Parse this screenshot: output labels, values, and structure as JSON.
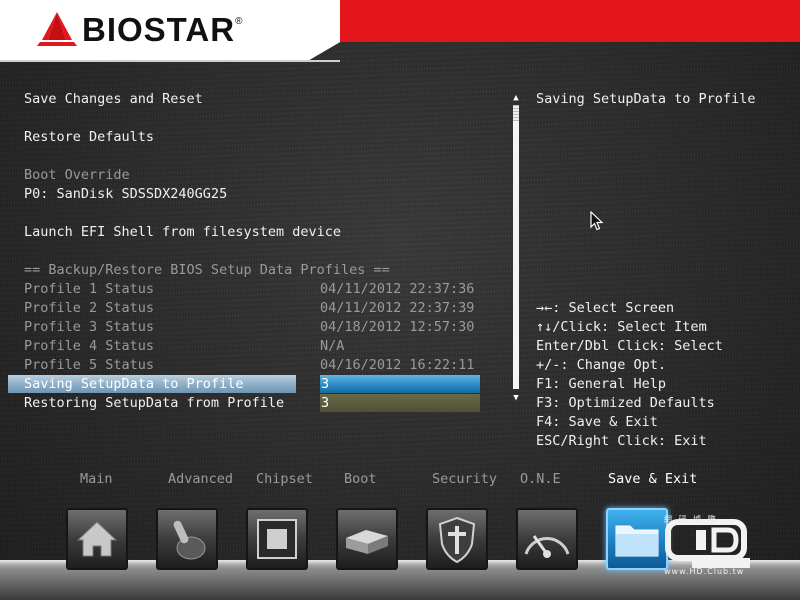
{
  "brand": {
    "name": "BIOSTAR",
    "registered": "®"
  },
  "menu": {
    "save_changes_reset": "Save Changes and Reset",
    "restore_defaults": "Restore Defaults",
    "boot_override_header": "Boot Override",
    "boot_device": "P0: SanDisk SDSSDX240GG25",
    "launch_efi_shell": "Launch EFI Shell from filesystem device",
    "profiles_header": "== Backup/Restore BIOS Setup Data Profiles ==",
    "profiles": [
      {
        "label": "Profile 1 Status",
        "value": "04/11/2012 22:37:36"
      },
      {
        "label": "Profile 2 Status",
        "value": "04/11/2012 22:37:39"
      },
      {
        "label": "Profile 3 Status",
        "value": "04/18/2012 12:57:30"
      },
      {
        "label": "Profile 4 Status",
        "value": "N/A"
      },
      {
        "label": "Profile 5 Status",
        "value": "04/16/2012 16:22:11"
      }
    ],
    "saving_label": "Saving SetupData to Profile",
    "saving_value": "3",
    "restoring_label": "Restoring SetupData from Profile",
    "restoring_value": "3"
  },
  "help": {
    "description": "Saving SetupData to Profile",
    "keys": [
      {
        "key": "→←",
        "text": ": Select Screen"
      },
      {
        "key": "↑↓",
        "text": "/Click: Select Item"
      },
      {
        "key": "",
        "text": "Enter/Dbl Click: Select"
      },
      {
        "key": "",
        "text": "+/-: Change Opt."
      },
      {
        "key": "",
        "text": "F1: General Help"
      },
      {
        "key": "",
        "text": "F3: Optimized Defaults"
      },
      {
        "key": "",
        "text": "F4: Save & Exit"
      },
      {
        "key": "",
        "text": "ESC/Right Click: Exit"
      }
    ]
  },
  "tabs": [
    {
      "label": "Main",
      "icon": "home-icon",
      "active": false
    },
    {
      "label": "Advanced",
      "icon": "joystick-icon",
      "active": false
    },
    {
      "label": "Chipset",
      "icon": "chip-icon",
      "active": false
    },
    {
      "label": "Boot",
      "icon": "drive-icon",
      "active": false
    },
    {
      "label": "Security",
      "icon": "shield-icon",
      "active": false
    },
    {
      "label": "O.N.E",
      "icon": "gauge-icon",
      "active": false
    },
    {
      "label": "Save & Exit",
      "icon": "folder-exit-icon",
      "active": true
    }
  ],
  "watermark": {
    "chinese": "網 研 據 際",
    "url": "www.HD.Club.tw",
    "logo_text": "HD CLUB"
  },
  "colors": {
    "header_red": "#e4151b",
    "highlight_blue": "#2b8cc6",
    "text_dim": "#9a9a9a"
  }
}
